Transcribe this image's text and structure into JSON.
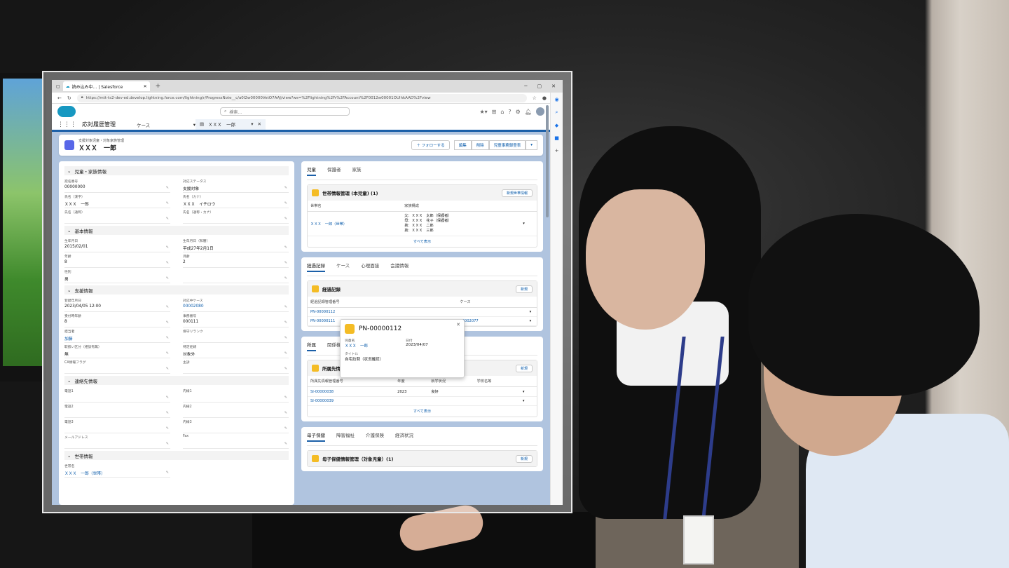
{
  "browser": {
    "tab_title": "読み込み中... | Salesforce",
    "url": "https://mtt-ts2-dev-ed.develop.lightning.force.com/lightning/r/ProgressNote__c/a0I2w00000VetO7AAJ/view?ws=%2Flightning%2Fr%2FAccount%2F0012w00001OUlhkAAD%2Fview"
  },
  "header": {
    "search_placeholder": "検索..."
  },
  "nav": {
    "app_name": "応対履歴管理",
    "items": [
      "ケース",
      "ＸＸＸ　一郎"
    ]
  },
  "record": {
    "subtitle": "支援対象児童・対象家族管理",
    "title": "ＸＸＸ　一郎",
    "buttons": [
      "＋ フォローする",
      "編集",
      "削除",
      "児童事務録登表"
    ]
  },
  "left": {
    "sections": [
      {
        "title": "児童・家族情報",
        "fields": [
          {
            "label": "宛名番号",
            "value": "00000000"
          },
          {
            "label": "対応ステータス",
            "value": "支援対象"
          },
          {
            "label": "氏名（漢字）",
            "value": "ＸＸＸ　一郎"
          },
          {
            "label": "氏名（カナ）",
            "value": "ＸＸＸ　イチロウ"
          },
          {
            "label": "氏名（通称）",
            "value": ""
          },
          {
            "label": "氏名（通称・カナ）",
            "value": ""
          }
        ]
      },
      {
        "title": "基本情報",
        "fields": [
          {
            "label": "生年月日",
            "value": "2015/02/01"
          },
          {
            "label": "生年月日（和暦）",
            "value": "平成27年2月1日"
          },
          {
            "label": "年齢",
            "value": "8"
          },
          {
            "label": "月齢",
            "value": "2"
          },
          {
            "label": "性別",
            "value": "男"
          },
          {
            "label": "",
            "value": ""
          }
        ]
      },
      {
        "title": "支援情報",
        "fields": [
          {
            "label": "登録年月日",
            "value": "2023/04/05 12:00"
          },
          {
            "label": "対応中ケース",
            "value": "00002080",
            "link": true
          },
          {
            "label": "受付時年齢",
            "value": "8"
          },
          {
            "label": "事務番号",
            "value": "000111"
          },
          {
            "label": "担当者",
            "value": "加藤",
            "link": true
          },
          {
            "label": "保守リランク",
            "value": ""
          },
          {
            "label": "取扱い区分（相談有無）",
            "value": "無"
          },
          {
            "label": "特定妊婦",
            "value": "対象外"
          },
          {
            "label": "CA情報フラグ",
            "value": ""
          },
          {
            "label": "主訴",
            "value": ""
          }
        ]
      },
      {
        "title": "連絡先情報",
        "fields": [
          {
            "label": "電話1",
            "value": ""
          },
          {
            "label": "内線1",
            "value": ""
          },
          {
            "label": "電話2",
            "value": ""
          },
          {
            "label": "内線2",
            "value": ""
          },
          {
            "label": "電話3",
            "value": ""
          },
          {
            "label": "内線3",
            "value": ""
          },
          {
            "label": "メールアドレス",
            "value": ""
          },
          {
            "label": "Fax",
            "value": ""
          }
        ]
      },
      {
        "title": "世帯情報",
        "fields": [
          {
            "label": "世帯名",
            "value": "ＸＸＸ　一郎（世帯）",
            "link": true
          }
        ]
      }
    ]
  },
  "card1": {
    "tabs": [
      "児童",
      "保護者",
      "家族"
    ],
    "list_title": "世帯情報管理 (本児童) (1)",
    "button": "新規世帯情報",
    "columns": [
      "世帯名",
      "家族構成"
    ],
    "rows": [
      {
        "name": "ＸＸＸ　一郎（世帯）",
        "family": "父：ＸＸＸ　太郎（保護者）\n母：ＸＸＸ　花子（保護者）\n弟：ＸＸＸ　二郎\n弟：ＸＸＸ　三郎"
      }
    ],
    "view_all": "すべて表示"
  },
  "card2": {
    "tabs": [
      "経過記録",
      "ケース",
      "心理面接",
      "会議情報"
    ],
    "list_title": "経過記録",
    "button": "新規",
    "columns": [
      "経過記録管理番号",
      "ケース"
    ],
    "rows": [
      {
        "id": "PN-00000112",
        "case": ""
      },
      {
        "id": "PN-00000111",
        "case": "00002077"
      }
    ]
  },
  "popup": {
    "title": "PN-00000112",
    "fields": [
      {
        "label": "児童名",
        "value": "ＸＸＸ　一郎",
        "link": true
      },
      {
        "label": "日付",
        "value": "2023/04/07"
      },
      {
        "label": "タイトル",
        "value": "自宅訪問（状況確認）"
      }
    ]
  },
  "card3": {
    "tabs": [
      "所属",
      "関係機関"
    ],
    "list_title": "所属先情報管理 (2)",
    "button": "新規",
    "columns": [
      "所属先情報管理番号",
      "年度",
      "就学状況",
      "学校名等"
    ],
    "rows": [
      {
        "id": "SI-00000038",
        "year": "2023",
        "status": "良好",
        "school": ""
      },
      {
        "id": "SI-00000039",
        "year": "",
        "status": "",
        "school": ""
      }
    ],
    "view_all": "すべて表示"
  },
  "card4": {
    "tabs": [
      "母子保健",
      "障害福祉",
      "介護保険",
      "経済状況"
    ],
    "list_title": "母子保健情報管理（対象児童）(1)",
    "button": "新規"
  }
}
